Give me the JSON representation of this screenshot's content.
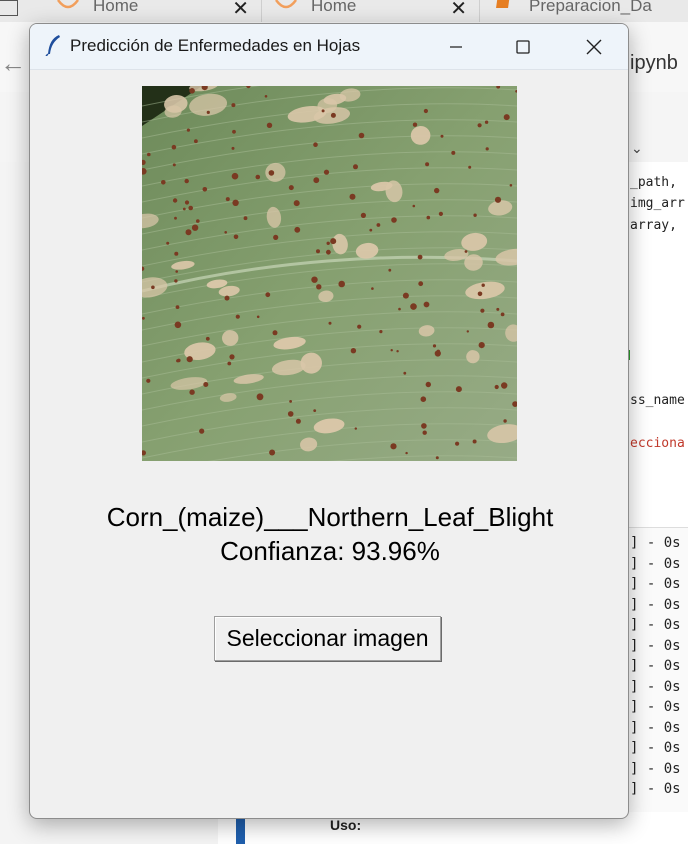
{
  "background": {
    "tabs": [
      {
        "label": "Home",
        "icon": "jupyter-icon"
      },
      {
        "label": "Home",
        "icon": "jupyter-icon"
      },
      {
        "label": "Preparacion_Da",
        "icon": "notebook-icon"
      }
    ],
    "tab_close": "✕",
    "file_title": "ipynb",
    "code_lines": [
      "_path,",
      "img_arr",
      "array,",
      "ss_name",
      "ecciona"
    ],
    "output_line": "] - 0s",
    "footer_label": "Uso:"
  },
  "window": {
    "title": "Predicción de Enfermedades en Hojas",
    "icon": "feather-icon",
    "image": {
      "subject": "corn-leaf-with-lesions-icon"
    },
    "prediction": "Corn_(maize)___Northern_Leaf_Blight",
    "confidence": "Confianza: 93.96%",
    "button_label": "Seleccionar imagen"
  },
  "colors": {
    "window_bg": "#f0f0f0",
    "titlebar_bg": "#eef4fa",
    "leaf_green": "#7d9a68",
    "lesion_tan": "#d9c6a8",
    "spot_brown": "#7a3a22"
  }
}
